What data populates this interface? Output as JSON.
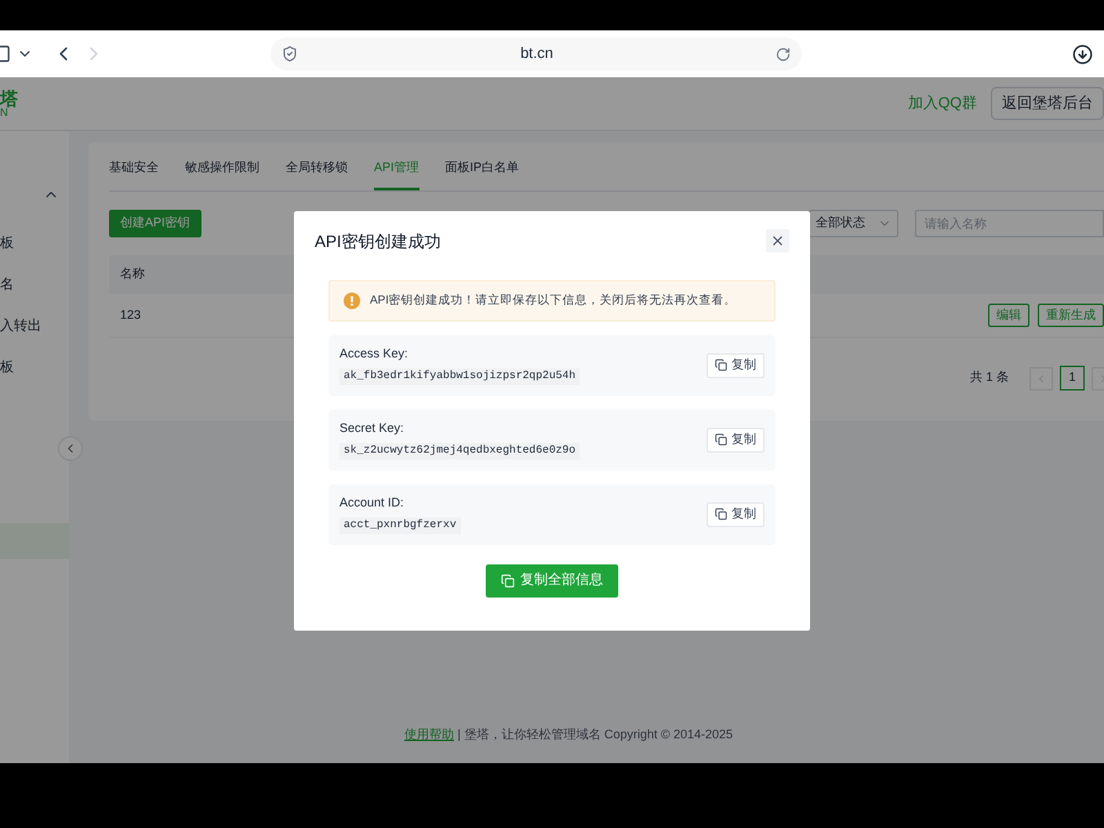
{
  "browser": {
    "url": "bt.cn"
  },
  "header": {
    "logo": "塔",
    "logo_sub": "N",
    "qq_link": "加入QQ群",
    "back_button": "返回堡塔后台"
  },
  "sidebar": {
    "group_expanded": true,
    "items": [
      {
        "label": "板",
        "selected": false
      },
      {
        "label": "名",
        "selected": false
      },
      {
        "label": "入转出",
        "selected": false
      },
      {
        "label": "板",
        "selected": false
      },
      {
        "selected": true
      }
    ]
  },
  "tabs": [
    {
      "label": "基础安全",
      "selected": false
    },
    {
      "label": "敏感操作限制",
      "selected": false
    },
    {
      "label": "全局转移锁",
      "selected": false
    },
    {
      "label": "API管理",
      "selected": true
    },
    {
      "label": "面板IP白名单",
      "selected": false
    }
  ],
  "create_button": "创建API密钥",
  "status_filter": "全部状态",
  "search": {
    "placeholder": "请输入名称"
  },
  "table": {
    "columns": [
      "名称"
    ],
    "rows": [
      {
        "cells": [
          "123"
        ],
        "actions": [
          "编辑",
          "重新生成"
        ]
      }
    ]
  },
  "pagination": {
    "total": "共 1 条",
    "pages": [
      {
        "label": "1",
        "selected": true
      }
    ]
  },
  "footer": {
    "link": "使用帮助",
    "text": "| 堡塔，让你轻松管理域名 Copyright © 2014-2025"
  },
  "dialog": {
    "title": "API密钥创建成功",
    "alert": "API密钥创建成功！请立即保存以下信息，关闭后将无法再次查看。",
    "fields": [
      {
        "label": "Access Key:",
        "value": "ak_fb3edr1kifyabbw1sojizpsr2qp2u54h",
        "copy": "复制"
      },
      {
        "label": "Secret Key:",
        "value": "sk_z2ucwytz62jmej4qedbxeghted6e0z9o",
        "copy": "复制"
      },
      {
        "label": "Account ID:",
        "value": "acct_pxnrbgfzerxv",
        "copy": "复制"
      }
    ],
    "copy_all": "复制全部信息"
  }
}
